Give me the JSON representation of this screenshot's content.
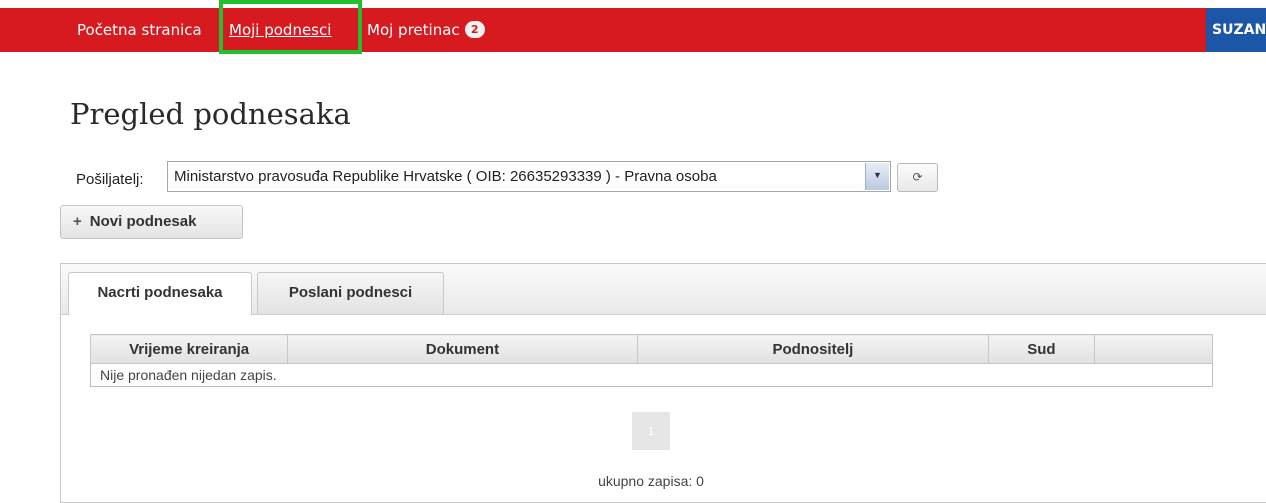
{
  "nav": {
    "home": "Početna stranica",
    "my_submissions": "Moji podnesci",
    "my_inbox": "Moj pretinac",
    "inbox_count": "2",
    "user": "SUZANA"
  },
  "page_title": "Pregled podnesaka",
  "sender": {
    "label": "Pošiljatelj:",
    "value": "Ministarstvo pravosuđa Republike Hrvatske ( OIB: 26635293339 ) - Pravna osoba",
    "refresh_icon": "refresh-icon"
  },
  "actions": {
    "new_label": "Novi podnesak",
    "new_icon": "+"
  },
  "tabs": [
    {
      "label": "Nacrti podnesaka",
      "active": true
    },
    {
      "label": "Poslani podnesci",
      "active": false
    }
  ],
  "table": {
    "columns": [
      "Vrijeme kreiranja",
      "Dokument",
      "Podnositelj",
      "Sud",
      ""
    ],
    "empty_message": "Nije pronađen nijedan zapis."
  },
  "pagination": {
    "page": "1",
    "total": "ukupno zapisa: 0"
  },
  "colors": {
    "nav_bg": "#d71a1f",
    "user_bg": "#1b57a6",
    "highlight": "#22c02e"
  }
}
